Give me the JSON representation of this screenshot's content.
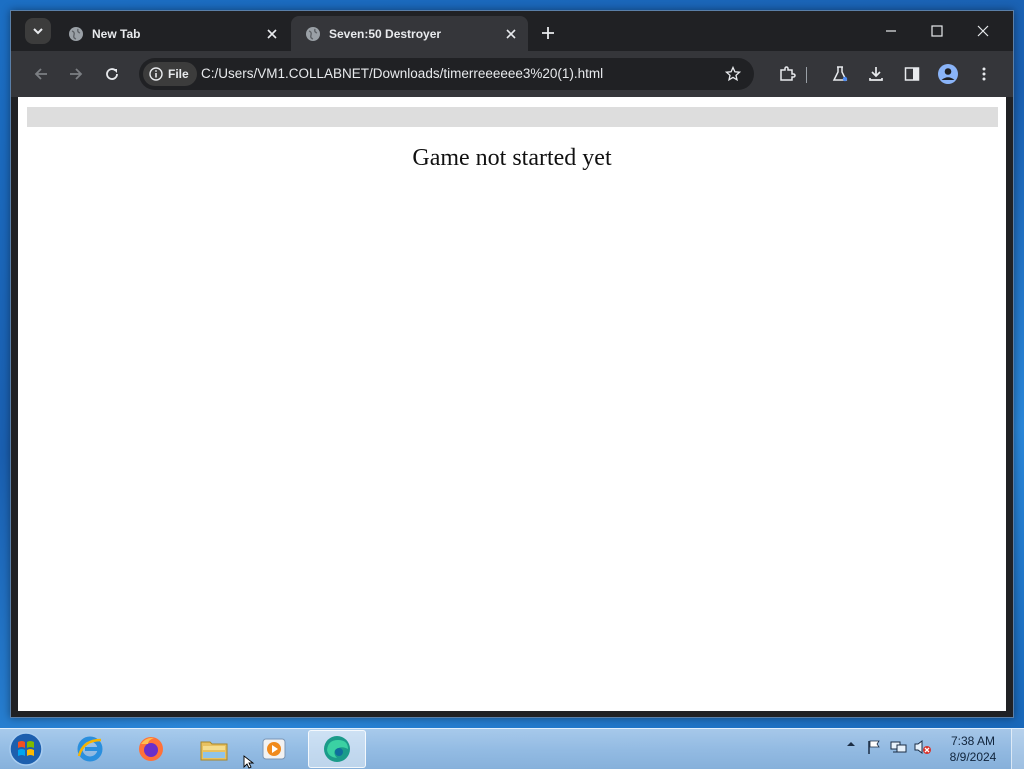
{
  "browser": {
    "tabs": [
      {
        "title": "New Tab",
        "active": false
      },
      {
        "title": "Seven:50 Destroyer",
        "active": true
      }
    ],
    "omnibox": {
      "chip_label": "File",
      "url": "C:/Users/VM1.COLLABNET/Downloads/timerreeeeee3%20(1).html"
    }
  },
  "page": {
    "status_text": "Game not started yet",
    "progress": 0
  },
  "taskbar": {
    "pinned": [
      "internet-explorer-icon",
      "firefox-icon",
      "file-explorer-icon",
      "media-player-icon",
      "edge-icon"
    ],
    "clock": {
      "time": "7:38 AM",
      "date": "8/9/2024"
    }
  },
  "colors": {
    "tabstrip": "#202124",
    "toolbar": "#35363a",
    "progress_track": "#dddddd"
  }
}
